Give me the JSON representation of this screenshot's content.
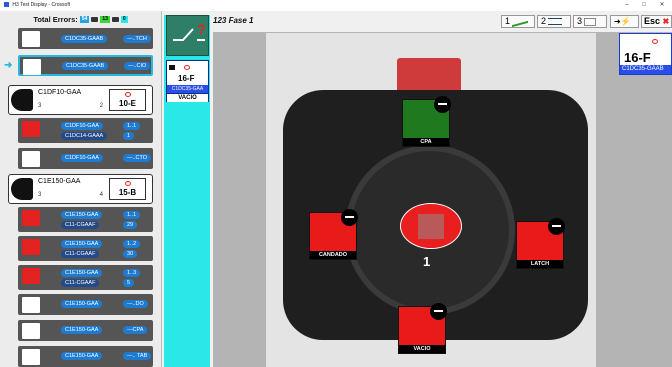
{
  "window": {
    "title": "H3 Test Display - Crossoft",
    "minimize": "–",
    "maximize": "□",
    "close": "✕"
  },
  "summary": {
    "label": "Total Errors:",
    "counts": [
      "54",
      "13",
      "0"
    ],
    "colors": {
      "blue": "#2aa1e0",
      "green": "#3dd33d",
      "cyan": "#2ae8e8"
    }
  },
  "tests": [
    {
      "circuit": "C1DC35-GAAB",
      "result": "—..TCH"
    },
    {
      "circuit": "C1DC35-GAAB",
      "result": "—..CIO",
      "selected": true
    },
    {
      "cable": "C1DF10-GAA",
      "count": "3",
      "pins": "2",
      "label": "10-E"
    },
    {
      "circuit": "C1DF10-GAA",
      "circuit2": "C1DC14-GAAA",
      "r1": "1..1",
      "r2": "1"
    },
    {
      "circuit": "C1DF10-GAA",
      "result": "—..CTO"
    },
    {
      "cable": "C1E150-GAA",
      "count": "3",
      "pins": "4",
      "label": "15-B"
    },
    {
      "circuit": "C1E150-GAA",
      "circuit2": "C11-CGAAF",
      "r1": "1..1",
      "r2": "29"
    },
    {
      "circuit": "C1E150-GAA",
      "circuit2": "C11-CGAAF",
      "r1": "1..2",
      "r2": "30"
    },
    {
      "circuit": "C1E150-GAA",
      "circuit2": "C11-CGAAF",
      "r1": "1..3",
      "r2": "5"
    },
    {
      "circuit": "C1E150-GAA",
      "result": "—..DO"
    },
    {
      "circuit": "C1E150-GAA",
      "result": "—CPA"
    },
    {
      "circuit": "C1E150-GAA",
      "result": "—.. TAB"
    }
  ],
  "mid": {
    "card_number": "16-F",
    "card_code": "C1DC35-GAA",
    "card_sub": "VACIO"
  },
  "toolbar": {
    "fase": "123 Fase 1",
    "b1": "1",
    "b2": "2",
    "b3": "3",
    "esc": "Esc"
  },
  "main": {
    "cavities": {
      "cpa": "CPA",
      "candado": "CANDADO",
      "latch": "LATCH",
      "vacio": "VACIO"
    },
    "center_number": "1"
  },
  "right_card": {
    "number": "16-F",
    "code": "C1DC35-GAAB"
  }
}
